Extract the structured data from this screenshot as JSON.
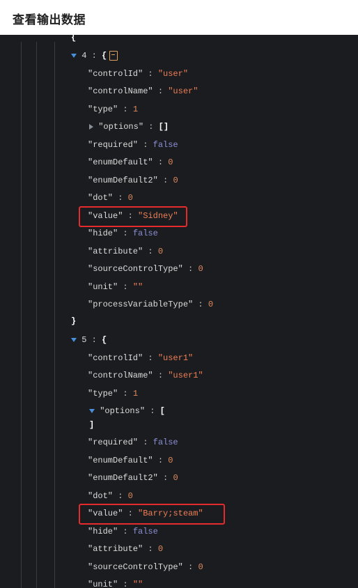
{
  "header": {
    "title": "查看输出数据"
  },
  "items": [
    {
      "index": "4",
      "fields": [
        {
          "key": "controlId",
          "value": "\"user\"",
          "type": "string"
        },
        {
          "key": "controlName",
          "value": "\"user\"",
          "type": "string"
        },
        {
          "key": "type",
          "value": "1",
          "type": "number"
        },
        {
          "key": "options",
          "value": "[]",
          "type": "array-collapsed"
        },
        {
          "key": "required",
          "value": "false",
          "type": "bool"
        },
        {
          "key": "enumDefault",
          "value": "0",
          "type": "number"
        },
        {
          "key": "enumDefault2",
          "value": "0",
          "type": "number"
        },
        {
          "key": "dot",
          "value": "0",
          "type": "number"
        },
        {
          "key": "value",
          "value": "\"Sidney\"",
          "type": "string"
        },
        {
          "key": "hide",
          "value": "false",
          "type": "bool"
        },
        {
          "key": "attribute",
          "value": "0",
          "type": "number"
        },
        {
          "key": "sourceControlType",
          "value": "0",
          "type": "number"
        },
        {
          "key": "unit",
          "value": "\"\"",
          "type": "string"
        },
        {
          "key": "processVariableType",
          "value": "0",
          "type": "number"
        }
      ]
    },
    {
      "index": "5",
      "fields": [
        {
          "key": "controlId",
          "value": "\"user1\"",
          "type": "string"
        },
        {
          "key": "controlName",
          "value": "\"user1\"",
          "type": "string"
        },
        {
          "key": "type",
          "value": "1",
          "type": "number"
        },
        {
          "key": "options",
          "value": "[",
          "type": "array-open"
        },
        {
          "key": "required",
          "value": "false",
          "type": "bool"
        },
        {
          "key": "enumDefault",
          "value": "0",
          "type": "number"
        },
        {
          "key": "enumDefault2",
          "value": "0",
          "type": "number"
        },
        {
          "key": "dot",
          "value": "0",
          "type": "number"
        },
        {
          "key": "value",
          "value": "\"Barry;steam\"",
          "type": "string"
        },
        {
          "key": "hide",
          "value": "false",
          "type": "bool"
        },
        {
          "key": "attribute",
          "value": "0",
          "type": "number"
        },
        {
          "key": "sourceControlType",
          "value": "0",
          "type": "number"
        },
        {
          "key": "unit",
          "value": "\"\"",
          "type": "string"
        }
      ]
    }
  ],
  "symbols": {
    "open_brace": "{",
    "close_brace": "}",
    "open_bracket": "[",
    "close_bracket": "]",
    "colon": ":",
    "empty_array": "[]"
  },
  "colors": {
    "string": "#ef7f57",
    "number": "#e08a5f",
    "bool": "#8c8fd6",
    "highlight": "#e52b2b",
    "expand_arrow": "#4a8fdb"
  },
  "icons": {
    "copy": "copy-icon",
    "expand": "chevron-down-icon",
    "collapse": "chevron-right-icon"
  }
}
